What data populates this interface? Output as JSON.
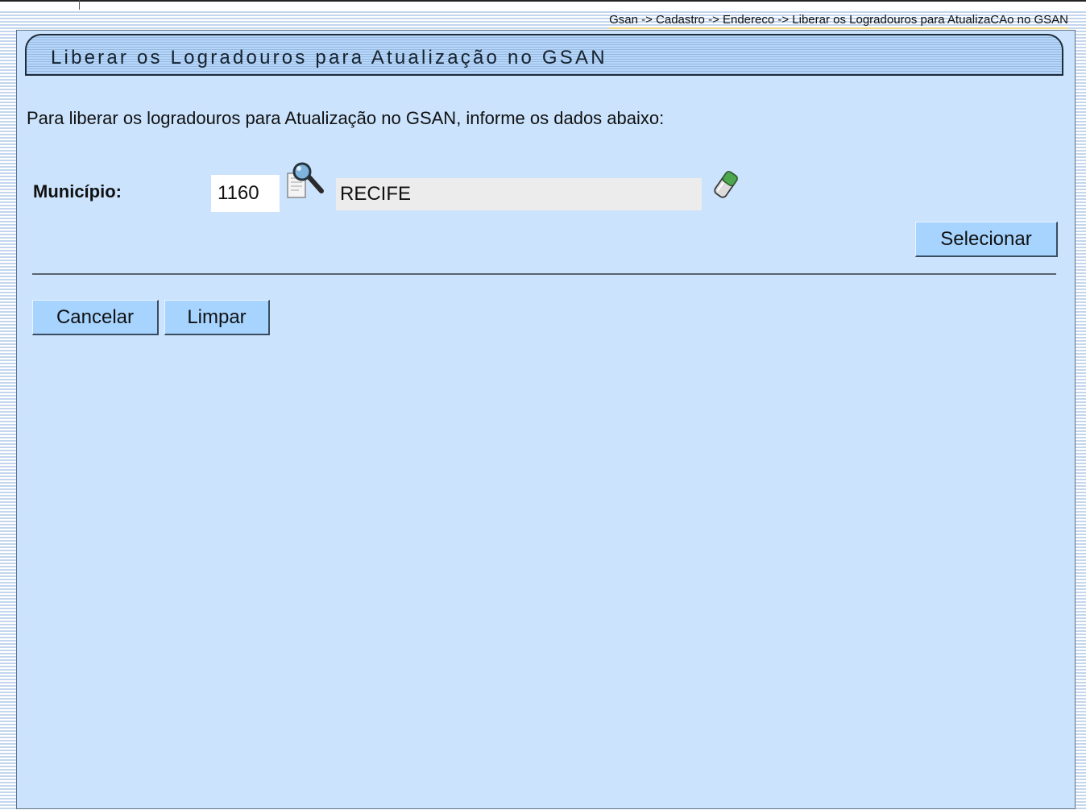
{
  "breadcrumb": "Gsan -> Cadastro -> Endereco -> Liberar os Logradouros para AtualizaCAo no GSAN",
  "page": {
    "title": "Liberar os Logradouros para Atualização no GSAN",
    "instructions": "Para liberar os logradouros para Atualização no GSAN, informe os dados abaixo:"
  },
  "form": {
    "municipio_label": "Município:",
    "municipio_code": "1160",
    "municipio_name": "RECIFE",
    "search_icon": "magnifier-search-icon",
    "clear_icon": "eraser-icon"
  },
  "buttons": {
    "select": "Selecionar",
    "cancel": "Cancelar",
    "clear": "Limpar"
  },
  "colors": {
    "panel_background": "#cbe3fc",
    "title_bar": "#a5c9f0",
    "button": "#a6d4ff",
    "display_field": "#ececec"
  }
}
